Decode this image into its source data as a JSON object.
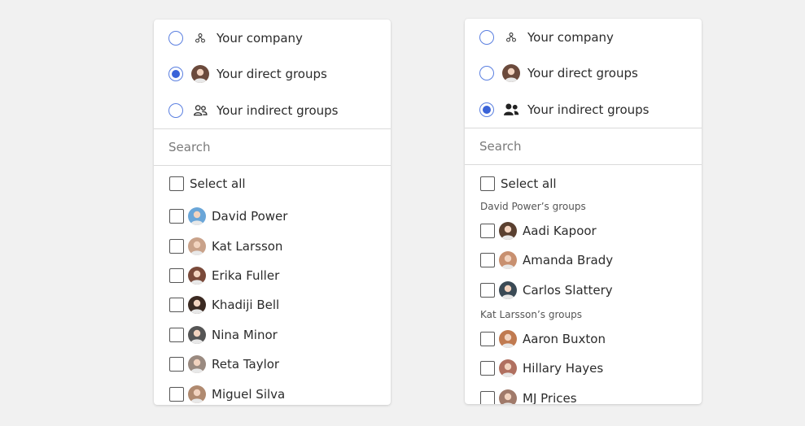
{
  "left_panel": {
    "options": [
      {
        "label": "Your company",
        "icon": "org-chart-icon",
        "checked": false
      },
      {
        "label": "Your direct groups",
        "icon": "avatar-icon",
        "checked": true
      },
      {
        "label": "Your indirect groups",
        "icon": "people-icon",
        "checked": false
      }
    ],
    "search_placeholder": "Search",
    "select_all": "Select all",
    "people": [
      {
        "name": "David Power",
        "avatar_color": "#6aa6d8"
      },
      {
        "name": "Kat Larsson",
        "avatar_color": "#c9a28a"
      },
      {
        "name": "Erika Fuller",
        "avatar_color": "#7a4a3a"
      },
      {
        "name": "Khadiji Bell",
        "avatar_color": "#3b2a22"
      },
      {
        "name": "Nina Minor",
        "avatar_color": "#555555"
      },
      {
        "name": "Reta Taylor",
        "avatar_color": "#9a8a80"
      },
      {
        "name": "Miguel Silva",
        "avatar_color": "#b08a70"
      }
    ]
  },
  "right_panel": {
    "options": [
      {
        "label": "Your company",
        "icon": "org-chart-icon",
        "checked": false
      },
      {
        "label": "Your direct groups",
        "icon": "avatar-icon",
        "checked": false
      },
      {
        "label": "Your indirect groups",
        "icon": "people-filled-icon",
        "checked": true
      }
    ],
    "search_placeholder": "Search",
    "select_all": "Select all",
    "groups": [
      {
        "header": "David Power’s groups",
        "people": [
          {
            "name": "Aadi Kapoor",
            "avatar_color": "#5a4030"
          },
          {
            "name": "Amanda Brady",
            "avatar_color": "#c89070"
          },
          {
            "name": "Carlos Slattery",
            "avatar_color": "#3a4a55"
          }
        ]
      },
      {
        "header": "Kat Larsson’s groups",
        "people": [
          {
            "name": "Aaron Buxton",
            "avatar_color": "#c07a50"
          },
          {
            "name": "Hillary Hayes",
            "avatar_color": "#b07060"
          },
          {
            "name": "MJ Prices",
            "avatar_color": "#a07a6a"
          }
        ]
      }
    ]
  },
  "colors": {
    "accent": "#3a63d8",
    "radio_border": "#5a7fe0",
    "background": "#f1f1f1"
  }
}
